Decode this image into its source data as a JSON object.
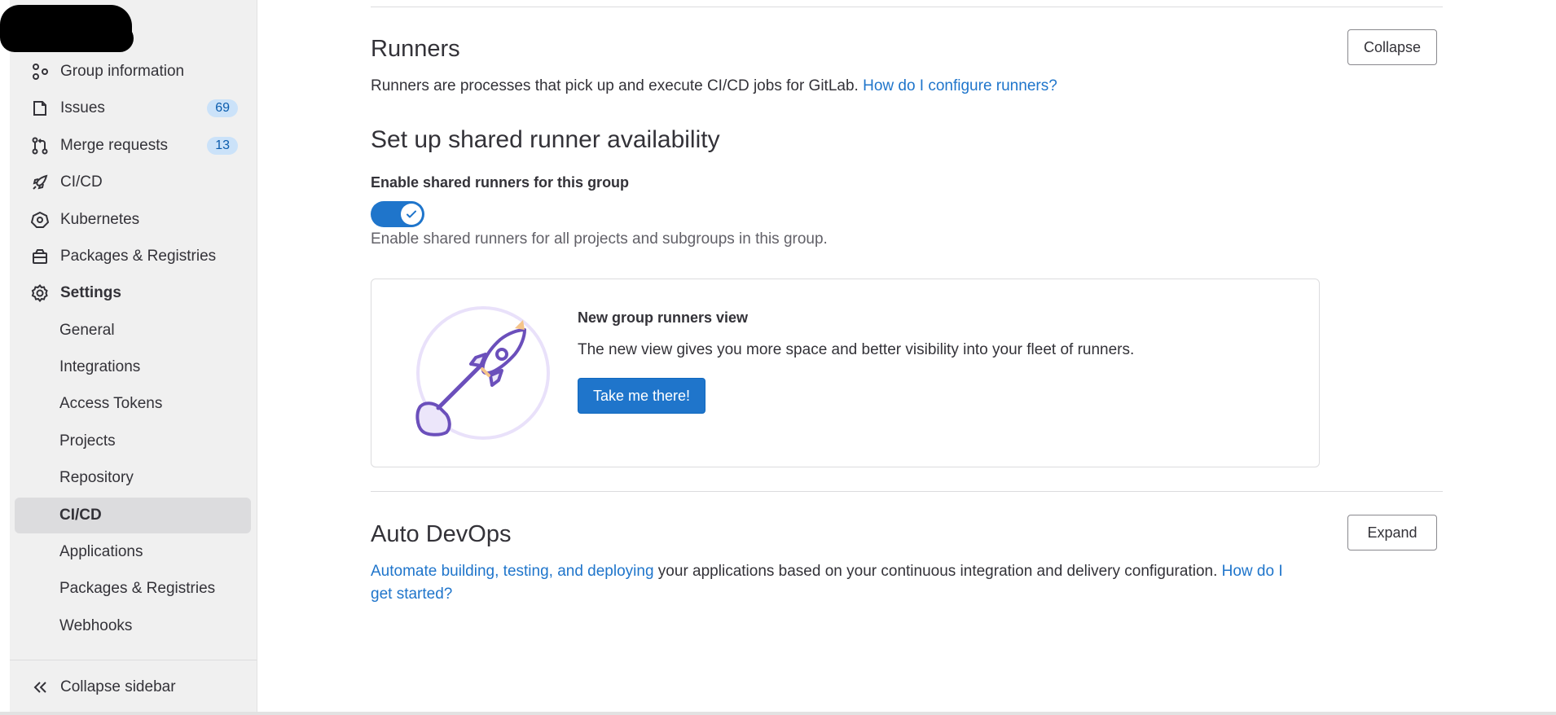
{
  "sidebar": {
    "items": [
      {
        "label": "Group information",
        "icon": "group-icon"
      },
      {
        "label": "Issues",
        "icon": "issues-icon",
        "badge": "69"
      },
      {
        "label": "Merge requests",
        "icon": "merge-request-icon",
        "badge": "13"
      },
      {
        "label": "CI/CD",
        "icon": "rocket-icon"
      },
      {
        "label": "Kubernetes",
        "icon": "kubernetes-icon"
      },
      {
        "label": "Packages & Registries",
        "icon": "package-icon"
      },
      {
        "label": "Settings",
        "icon": "gear-icon"
      }
    ],
    "settings_items": [
      {
        "label": "General"
      },
      {
        "label": "Integrations"
      },
      {
        "label": "Access Tokens"
      },
      {
        "label": "Projects"
      },
      {
        "label": "Repository"
      },
      {
        "label": "CI/CD"
      },
      {
        "label": "Applications"
      },
      {
        "label": "Packages & Registries"
      },
      {
        "label": "Webhooks"
      }
    ],
    "collapse_label": "Collapse sidebar"
  },
  "runners": {
    "title": "Runners",
    "description": "Runners are processes that pick up and execute CI/CD jobs for GitLab.",
    "help_link": "How do I configure runners?",
    "collapse_button": "Collapse",
    "shared_title": "Set up shared runner availability",
    "toggle_label": "Enable shared runners for this group",
    "toggle_on": true,
    "toggle_help": "Enable shared runners for all projects and subgroups in this group.",
    "promo": {
      "title": "New group runners view",
      "text": "The new view gives you more space and better visibility into your fleet of runners.",
      "button": "Take me there!"
    }
  },
  "auto_devops": {
    "title": "Auto DevOps",
    "expand_button": "Expand",
    "link1": "Automate building, testing, and deploying",
    "text": " your applications based on your continuous integration and delivery configuration. ",
    "link2a": "How do I",
    "link2b": "get started?"
  },
  "colors": {
    "accent": "#1f75cb",
    "badge_bg": "#cbe2f9",
    "sidebar_bg": "#f0f0f0"
  }
}
